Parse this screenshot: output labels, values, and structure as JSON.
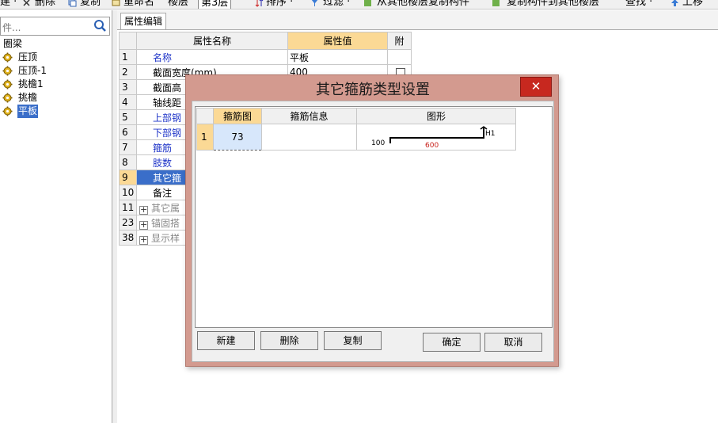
{
  "toolbar": {
    "items": [
      "建 ·",
      "删除",
      "复制",
      "重命名",
      "楼层",
      "第3层",
      "排序 ·",
      "过滤 ·",
      "从其他楼层复制构件",
      "复制构件到其他楼层",
      "查找 ·",
      "上移"
    ]
  },
  "left_panel": {
    "filter_placeholder": "件...",
    "tree": [
      {
        "label": "圈梁",
        "icon": "",
        "selected": false
      },
      {
        "label": "压顶",
        "icon": "gear-icon",
        "selected": false
      },
      {
        "label": "压顶-1",
        "icon": "gear-icon",
        "selected": false
      },
      {
        "label": "挑檐1",
        "icon": "gear-icon",
        "selected": false
      },
      {
        "label": "挑檐",
        "icon": "gear-icon",
        "selected": false
      },
      {
        "label": "平板",
        "icon": "gear-icon",
        "selected": true
      }
    ]
  },
  "right_panel": {
    "tab_label": "属性编辑",
    "grid": {
      "headers": [
        "",
        "属性名称",
        "属性值",
        "附"
      ],
      "rows": [
        {
          "num": "1",
          "name": "名称",
          "value": "平板",
          "style": "blue",
          "attach": false
        },
        {
          "num": "2",
          "name": "截面宽度(mm)",
          "value": "400",
          "style": "black",
          "attach": true
        },
        {
          "num": "3",
          "name": "截面高",
          "value": "",
          "style": "black",
          "attach": false
        },
        {
          "num": "4",
          "name": "轴线距",
          "value": "",
          "style": "black",
          "attach": false
        },
        {
          "num": "5",
          "name": "上部钢",
          "value": "",
          "style": "blue",
          "attach": false
        },
        {
          "num": "6",
          "name": "下部钢",
          "value": "",
          "style": "blue",
          "attach": false
        },
        {
          "num": "7",
          "name": "箍筋",
          "value": "",
          "style": "blue",
          "attach": false
        },
        {
          "num": "8",
          "name": "肢数",
          "value": "",
          "style": "blue",
          "attach": false
        },
        {
          "num": "9",
          "name": "其它箍",
          "value": "",
          "style": "selected",
          "attach": false
        },
        {
          "num": "10",
          "name": "备注",
          "value": "",
          "style": "black",
          "attach": false
        },
        {
          "num": "11",
          "name": "其它属",
          "value": "",
          "style": "gray",
          "attach": false
        },
        {
          "num": "23",
          "name": "锚固搭",
          "value": "",
          "style": "gray",
          "attach": false
        },
        {
          "num": "38",
          "name": "显示样",
          "value": "",
          "style": "gray",
          "attach": false
        }
      ]
    }
  },
  "dialog": {
    "title": "其它箍筋类型设置",
    "close_glyph": "✕",
    "headers": [
      "",
      "箍筋图",
      "箍筋信息",
      "图形"
    ],
    "rows": [
      {
        "num": "1",
        "figure": "73",
        "info": "",
        "shape": {
          "left_label": "100",
          "bottom_label": "600",
          "right_label": "H1"
        }
      }
    ],
    "buttons": {
      "new": "新建",
      "delete": "删除",
      "copy": "复制",
      "ok": "确定",
      "cancel": "取消"
    }
  },
  "colors": {
    "header_highlight": "#fbd995",
    "selection_blue": "#3a6ec9",
    "link_blue": "#1e34c8",
    "dialog_frame": "#d39a8f",
    "close_red": "#c7281f",
    "dimension_red": "#c8201a"
  }
}
